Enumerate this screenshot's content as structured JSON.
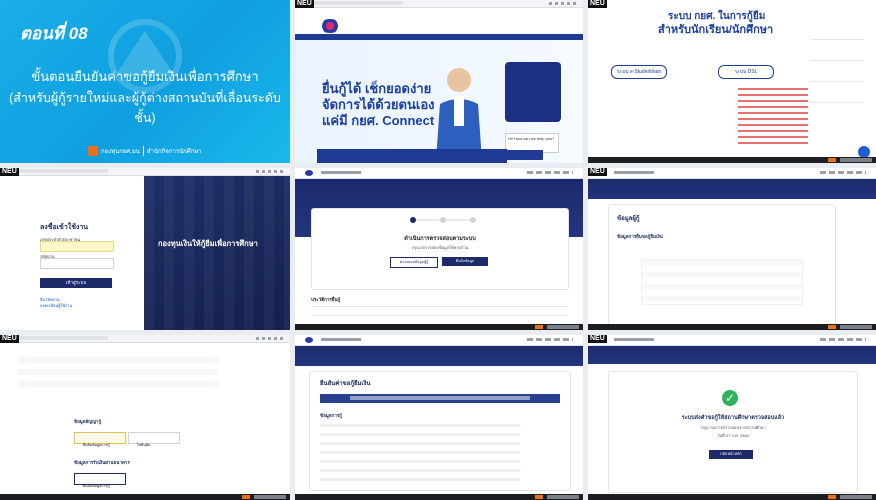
{
  "labels": {
    "brand_tag": "NEU"
  },
  "episode": {
    "number_label": "ตอนที่ 08",
    "title_line1": "ขั้นตอนยืนยันค่าขอกู้ยืมเงินเพื่อการศึกษา",
    "title_line2": "(สำหรับผู้กู้รายใหม่และผู้กู้ต่างสถานบันที่เลื่อนระดับชั้น)",
    "org_name": "กองทุนกยศ.มน",
    "org_sub": "สำนักกิจการนักศึกษา"
  },
  "website": {
    "banner_line1": "ยื่นกู้ได้ เช็กยอดง่าย",
    "banner_line2": "จัดการได้ด้วยตนเอง",
    "banner_line3": "แค่มี กยศ. Connect",
    "chat_text": "Hi! How can we help you?"
  },
  "portal": {
    "heading1": "ระบบ กยศ. ในการกู้ยืม",
    "heading2": "สำหรับนักเรียน/นักศึกษา",
    "btn_estudent": "ระบบ e-Studentloan",
    "btn_dsl": "ระบบ DSL"
  },
  "login": {
    "title": "ลงชื่อเข้าใช้งาน",
    "username_label": "เลขประจำตัวประชาชน",
    "password_label": "รหัสผ่าน",
    "login_button": "เข้าสู่ระบบ",
    "forgot_link": "ลืมรหัสผ่าน",
    "register_link": "ลงทะเบียนผู้ใช้งาน",
    "right_title": "กองทุนเงินให้กู้ยืมเพื่อการศึกษา"
  },
  "loan_form": {
    "title": "ดำเนินการตรวจสอบตามระบบ",
    "subtitle": "กรุณาตรวจสอบข้อมูลให้ครบถ้วน",
    "btn_secondary": "ตรวจสอบข้อมูลผู้กู้",
    "btn_primary": "ยืนยันข้อมูล",
    "section": "ประวัติการยื่นกู้"
  },
  "info": {
    "title": "ข้อมูลผู้กู้",
    "section": "ข้อมูลการยื่นขอกู้ยืมเงิน"
  },
  "choice": {
    "section1": "ข้อมูลสัญญากู้",
    "option1": "ยืนยันข้อมูลการกู้",
    "option2": "ไม่ยืนยัน",
    "section2": "ข้อมูลการรับเงินผ่านธนาคาร",
    "option3": "ยืนยันข้อมูลการกู้"
  },
  "confirm": {
    "title": "ยืนยันค่าขอกู้ยืมเงิน",
    "section": "ข้อมูลการกู้"
  },
  "success": {
    "message": "ระบบส่งคำขอกู้ให้สถานศึกษาตรวจสอบแล้ว",
    "line2": "กรุณารอการตรวจสอบจากสถานศึกษา",
    "line3": "วันที่ 07 ก.ค. 2566",
    "button": "กลับหน้าหลัก"
  }
}
